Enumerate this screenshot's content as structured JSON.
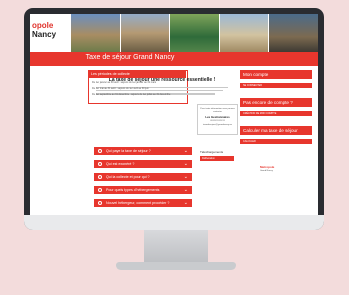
{
  "header": {
    "logo_line1": "opole",
    "logo_line2": "Nancy",
    "title": "Taxe de séjour Grand Nancy"
  },
  "main": {
    "heading": "La taxe de séjour une ressource essentielle !",
    "periods": {
      "title": "Les périodes de collecte",
      "lines": [
        "Du 1er janvier au 30 avril : séjours du 1er janvier au 31 mars",
        "Du 1er mai au 31 août : séjours du 1er avril au 30 juin",
        "Du 1er septembre au 31 décembre : séjours du 1er juillet au 31 décembre"
      ]
    },
    "info_box": {
      "line1": "Pour toute information vous pouvez",
      "line2": "contacter",
      "bold": "Les Gestionnaires",
      "line3": "03 83 91 83 91",
      "line4": "taxedesejour@grandnancy.eu"
    },
    "accordion": [
      "Qui paye la taxe de séjour ?",
      "Qui est exonéré ?",
      "Qui la collecte et pour qui ?",
      "Pour quels types d'hébergements",
      "Nouvel hébergeur, comment procéder ?"
    ],
    "downloads": {
      "title": "Téléchargements",
      "button": "Délibération"
    }
  },
  "sidebar": {
    "account_title": "Mon compte",
    "account_button": "SE CONNECTER",
    "no_account_title": "Pas encore de compte ?",
    "no_account_button": "CRÉATION DE MON COMPTE",
    "calc_title": "Calculer ma taxe de séjour",
    "calc_button": "CALCULER",
    "footer_logo_line1": "Metropole",
    "footer_logo_line2": "Grand Nancy"
  }
}
